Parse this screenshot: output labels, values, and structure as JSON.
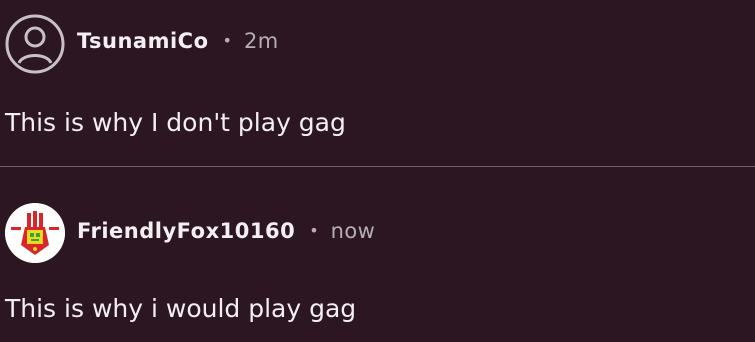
{
  "comments": [
    {
      "username": "TsunamiCo",
      "separator": "•",
      "time": "2m",
      "text": "This is why I don't play gag",
      "avatar_icon": "default-user-avatar-icon"
    },
    {
      "username": "FriendlyFox10160",
      "separator": "•",
      "time": "now",
      "text": "This is why i would play gag",
      "avatar_icon": "custom-robot-avatar-icon"
    }
  ],
  "colors": {
    "background": "#2c1622",
    "text": "#f3eef1",
    "muted": "#b8adb3",
    "divider": "#6f5f68",
    "avatar_outline": "#c9c0c5",
    "avatar_red": "#d8262b",
    "avatar_yellow": "#f4d81d",
    "avatar_green": "#2ca84d"
  }
}
